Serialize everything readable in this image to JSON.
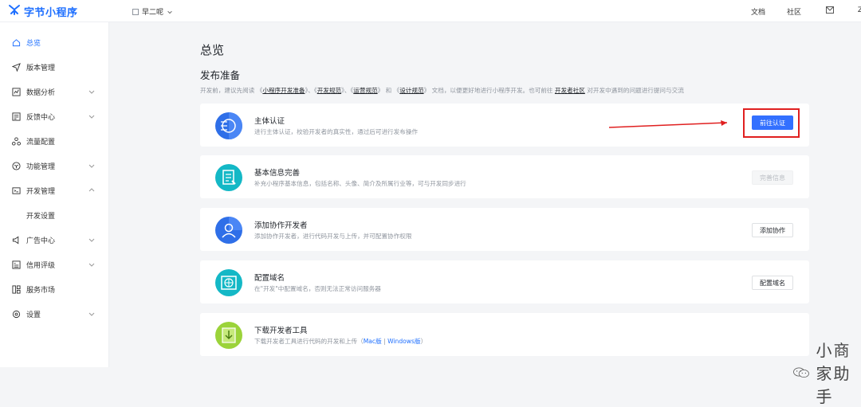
{
  "header": {
    "logo_text": "字节小程序",
    "app_name": "早二呢",
    "links": [
      "文档",
      "社区",
      "Z"
    ]
  },
  "sidebar": {
    "items": [
      {
        "label": "总览",
        "icon": "home-icon",
        "active": true
      },
      {
        "label": "版本管理",
        "icon": "send-icon"
      },
      {
        "label": "数据分析",
        "icon": "chart-icon",
        "chevron": "down"
      },
      {
        "label": "反馈中心",
        "icon": "feedback-icon",
        "chevron": "down"
      },
      {
        "label": "流量配置",
        "icon": "flow-icon"
      },
      {
        "label": "功能管理",
        "icon": "cube-icon",
        "chevron": "down"
      },
      {
        "label": "开发管理",
        "icon": "dev-icon",
        "chevron": "up"
      },
      {
        "label": "开发设置",
        "sub": true
      },
      {
        "label": "广告中心",
        "icon": "ad-icon",
        "chevron": "down"
      },
      {
        "label": "信用评级",
        "icon": "credit-icon",
        "chevron": "down"
      },
      {
        "label": "服务市场",
        "icon": "market-icon"
      },
      {
        "label": "设置",
        "icon": "settings-icon",
        "chevron": "down"
      }
    ]
  },
  "main": {
    "title": "总览",
    "section_title": "发布准备",
    "desc": {
      "p1": "开发前，建议先阅读 《",
      "l1": "小程序开发准备",
      "p2": "》、《",
      "l2": "开发规范",
      "p3": "》、《",
      "l3": "运营规范",
      "p4": "》 和 《",
      "l4": "设计规范",
      "p5": "》 文档，以便更好地进行小程序开发。也可前往 ",
      "l5": "开发者社区",
      "p6": " 对开发中遇到的问题进行提问与交流"
    },
    "cards": [
      {
        "title": "主体认证",
        "desc": "进行主体认证，校验开发者的真实性，通过后可进行发布操作",
        "button": "前往认证"
      },
      {
        "title": "基本信息完善",
        "desc": "补充小程序基本信息，包括名称、头像、简介及所属行业等，可与开发同步进行",
        "button": "完善信息"
      },
      {
        "title": "添加协作开发者",
        "desc": "添加协作开发者，进行代码开发与上传，并可配置协作权限",
        "button": "添加协作"
      },
      {
        "title": "配置域名",
        "desc": "在\"开发\"中配置域名，否则无法正常访问服务器",
        "button": "配置域名"
      },
      {
        "title": "下载开发者工具",
        "desc": "下载开发者工具进行代码的开发和上传（",
        "link1": "Mac版",
        "sep": "|",
        "link2": "Windows版",
        "desc_end": "）"
      }
    ]
  },
  "watermark": {
    "text": "小商家助手"
  },
  "colors": {
    "accent": "#3370ff",
    "highlight": "#e02020"
  }
}
